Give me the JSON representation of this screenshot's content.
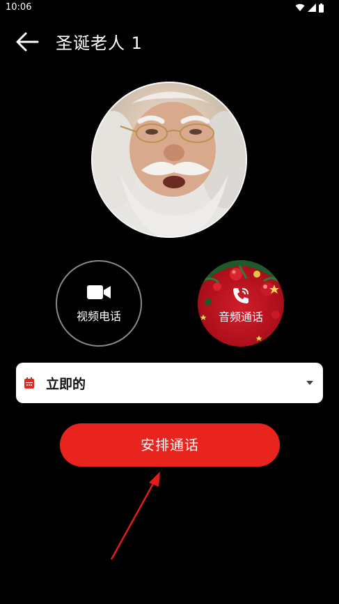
{
  "status_bar": {
    "time": "10:06"
  },
  "app_bar": {
    "title": "圣诞老人 1"
  },
  "call_options": [
    {
      "label": "视频电话",
      "icon": "video-camera-icon"
    },
    {
      "label": "音频通话",
      "icon": "phone-ringing-icon"
    }
  ],
  "schedule_select": {
    "selected": "立即的",
    "icon": "calendar-icon"
  },
  "primary_button": {
    "label": "安排通话"
  },
  "colors": {
    "accent": "#e9241e",
    "audio_bg": "#b0101c",
    "background": "#000000"
  }
}
